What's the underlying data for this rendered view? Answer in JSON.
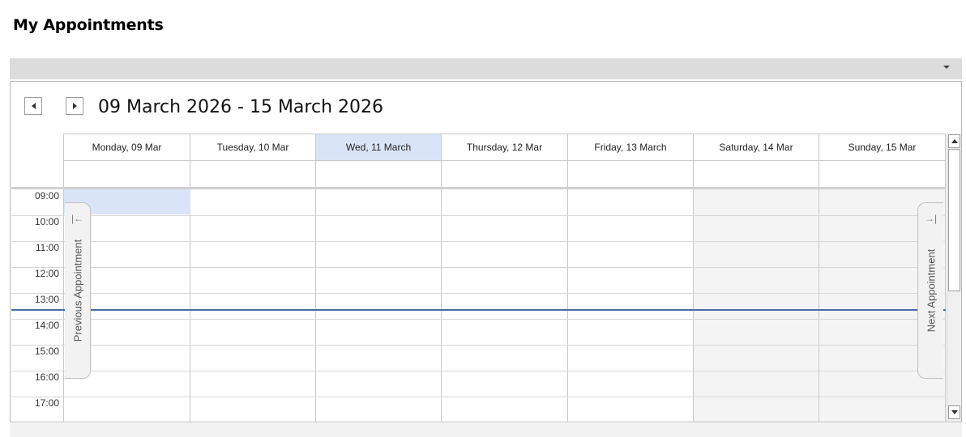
{
  "page": {
    "title": "My Appointments"
  },
  "navigator": {
    "date_range": "09 March 2026 - 15 March 2026",
    "prev_icon": "triangle-left-icon",
    "next_icon": "triangle-right-icon"
  },
  "days": [
    {
      "label": "Monday, 09 Mar",
      "today": false,
      "weekend": false
    },
    {
      "label": "Tuesday, 10 Mar",
      "today": false,
      "weekend": false
    },
    {
      "label": "Wed, 11 March",
      "today": true,
      "weekend": false
    },
    {
      "label": "Thursday, 12 Mar",
      "today": false,
      "weekend": false
    },
    {
      "label": "Friday, 13 March",
      "today": false,
      "weekend": false
    },
    {
      "label": "Saturday, 14 Mar",
      "today": false,
      "weekend": true
    },
    {
      "label": "Sunday, 15 Mar",
      "today": false,
      "weekend": true
    }
  ],
  "time_slots": [
    "09:00",
    "10:00",
    "11:00",
    "12:00",
    "13:00",
    "14:00",
    "15:00",
    "16:00",
    "17:00"
  ],
  "side_tabs": {
    "previous": "Previous Appointment",
    "next": "Next Appointment",
    "previous_icon": "arrow-to-left-icon",
    "next_icon": "arrow-to-right-icon"
  },
  "colors": {
    "today_highlight": "#d9e5f6",
    "now_line": "#4a6aa5"
  }
}
